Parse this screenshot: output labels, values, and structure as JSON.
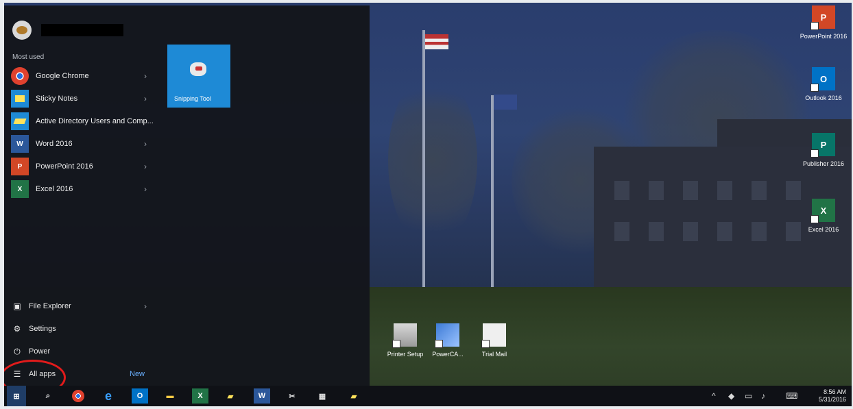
{
  "start_menu": {
    "section_label": "Most used",
    "apps": [
      {
        "label": "Google Chrome",
        "icon": "chrome-icon",
        "color": "#f2f2f2",
        "glyph": "●"
      },
      {
        "label": "Sticky Notes",
        "icon": "sticky-notes-icon",
        "color": "#1e8ad6",
        "glyph": "▰"
      },
      {
        "label": "Active Directory Users and Comp...",
        "icon": "active-directory-icon",
        "color": "#1e8ad6",
        "glyph": "▱"
      },
      {
        "label": "Word 2016",
        "icon": "word-icon",
        "color": "#2b579a",
        "glyph": "W"
      },
      {
        "label": "PowerPoint 2016",
        "icon": "powerpoint-icon",
        "color": "#d24726",
        "glyph": "P"
      },
      {
        "label": "Excel 2016",
        "icon": "excel-icon",
        "color": "#217346",
        "glyph": "X"
      }
    ],
    "tile": {
      "label": "Snipping Tool"
    },
    "system": {
      "file_explorer": "File Explorer",
      "settings": "Settings",
      "power": "Power",
      "all_apps": "All apps",
      "new": "New"
    }
  },
  "desktop_icons_right": [
    {
      "label": "PowerPoint 2016",
      "glyph": "P",
      "color": "#d24726"
    },
    {
      "label": "Outlook 2016",
      "glyph": "O",
      "color": "#0072c6"
    },
    {
      "label": "Publisher 2016",
      "glyph": "P",
      "color": "#077568"
    },
    {
      "label": "Excel 2016",
      "glyph": "X",
      "color": "#217346"
    }
  ],
  "desktop_icons_bottom": [
    {
      "label": "Printer Setup"
    },
    {
      "label": "PowerCA..."
    },
    {
      "label": "Trial Mail"
    }
  ],
  "taskbar": {
    "time": "8:56 AM",
    "date": "5/31/2016"
  }
}
